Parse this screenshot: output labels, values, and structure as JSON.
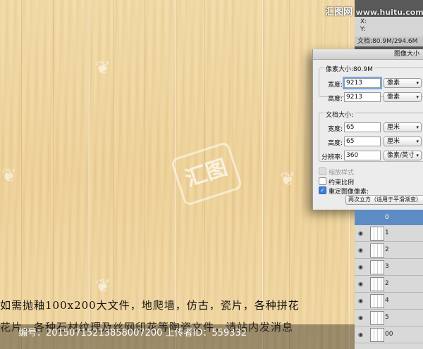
{
  "logo": {
    "brand": "汇图网",
    "url": "www.huitu.com"
  },
  "info_panel": {
    "x_label": "X:",
    "y_label": "Y:",
    "doc_size": "文档:80.9M/294.6M"
  },
  "dialog": {
    "title": "图像大小",
    "pixel_size_label": "像素大小:80.9M",
    "width_label": "宽度:",
    "height_label": "高度:",
    "pixel_width": "9213",
    "pixel_height": "9213",
    "pixel_unit": "像素",
    "doc_size_label": "文档大小:",
    "doc_width": "65",
    "doc_height": "65",
    "doc_unit": "厘米",
    "resolution_label": "分辨率:",
    "resolution": "360",
    "resolution_unit": "像素/英寸",
    "scale_styles": "缩放样式",
    "constrain": "约束比例",
    "resample": "重定图像像素:",
    "resample_method": "两次立方（适用于平滑渐变）"
  },
  "layers": [
    {
      "name": "0"
    },
    {
      "name": "1"
    },
    {
      "name": "2"
    },
    {
      "name": "3"
    },
    {
      "name": "2"
    },
    {
      "name": "4"
    },
    {
      "name": "5"
    },
    {
      "name": "00"
    }
  ],
  "caption": {
    "line1": "如需抛釉100x200大文件，地爬墙，仿古，瓷片，各种拼花",
    "line2": "花片，各种石材纹理及丝网印花等陶瓷文件，请站内发消息"
  },
  "footer": {
    "text": "编号：20150715213858007200 上传者ID：559332"
  },
  "watermark": "汇图"
}
